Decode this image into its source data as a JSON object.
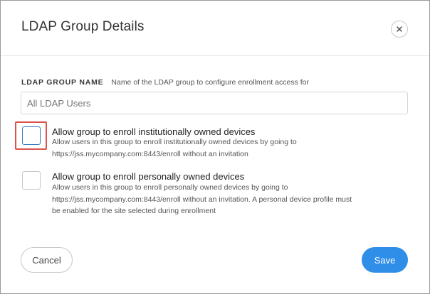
{
  "dialog": {
    "title": "LDAP Group Details",
    "close_icon": "close-icon"
  },
  "group_name_field": {
    "label": "LDAP GROUP NAME",
    "help": "Name of the LDAP group to configure enrollment access for",
    "placeholder": "All LDAP Users",
    "value": ""
  },
  "options": [
    {
      "title": "Allow group to enroll institutionally owned devices",
      "description_line1": "Allow users in this group to enroll institutionally owned devices by going to",
      "description_line2": "https://jss.mycompany.com:8443/enroll without an invitation",
      "checked": false,
      "highlighted": true
    },
    {
      "title": "Allow group to enroll personally owned devices",
      "description_line1": "Allow users in this group to enroll personally owned devices by going to",
      "description_line2": "https://jss.mycompany.com:8443/enroll without an invitation. A personal device profile must",
      "description_line3": "be enabled for the site selected during enrollment",
      "checked": false,
      "highlighted": false
    }
  ],
  "footer": {
    "cancel_label": "Cancel",
    "save_label": "Save"
  },
  "colors": {
    "primary": "#2f8ee8",
    "highlight": "#d9534f",
    "border": "#d6d6d6"
  }
}
